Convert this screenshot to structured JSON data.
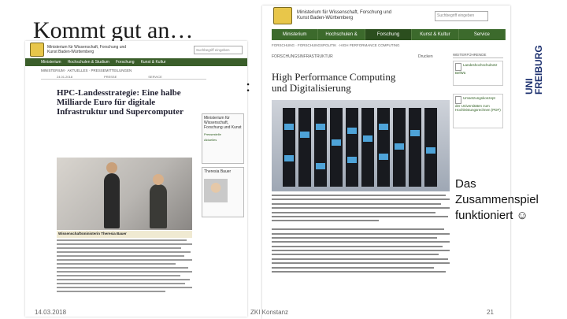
{
  "slide": {
    "title": "Kommt gut an…",
    "title_tail": ":",
    "callout_lines": [
      "Das",
      "Zusammenspiel",
      "funktioniert ☺"
    ],
    "footer": {
      "date": "14.03.2018",
      "center": "ZKI Konstanz",
      "page": "21"
    },
    "logo_text": [
      "UNI",
      "FREIBURG"
    ]
  },
  "left_shot": {
    "ministry": "Ministerium für Wissenschaft, Forschung und Kunst Baden-Württemberg",
    "search_placeholder": "Suchbegriff eingeben",
    "nav": [
      "Ministerium",
      "Hochschulen & Studium",
      "Forschung",
      "Kunst & Kultur"
    ],
    "crumb": "MINISTERIUM · AKTUELLES · PRESSEMITTEILUNGEN",
    "meta": [
      "24.01.2018",
      "PRESSE",
      "SERVICE"
    ],
    "headline": "HPC-Landesstrategie: Eine halbe Milliarde Euro für digitale Infrastruktur und Supercomputer",
    "caption": "Wissenschaftsministerin Theresia Bauer",
    "side_title": "Ministerium für Wissenschaft, Forschung und Kunst",
    "side_contact": "Theresia Bauer",
    "side_links": [
      "Pressestelle",
      "Aktuelles"
    ]
  },
  "right_shot": {
    "ministry": "Ministerium für Wissenschaft, Forschung und Kunst Baden-Württemberg",
    "search_placeholder": "Suchbegriff eingeben",
    "nav": [
      "Ministerium",
      "Hochschulen & Studium",
      "Forschung",
      "Kunst & Kultur",
      "Service"
    ],
    "active_nav": "Forschung",
    "crumb": "FORSCHUNG · FORSCHUNGSPOLITIK · HIGH PERFORMANCE COMPUTING",
    "sub": "FORSCHUNGSINFRASTRUKTUR",
    "print": "Drucken",
    "headline": "High Performance Computing und Digitalisierung",
    "side_head": "WEITERFÜHRENDE",
    "side_boxes": [
      "Landeshochschulnetz BelWü",
      "Umsetzungskonzept der Universitäten zum Hochleistungsrechnen (PDF)"
    ]
  }
}
